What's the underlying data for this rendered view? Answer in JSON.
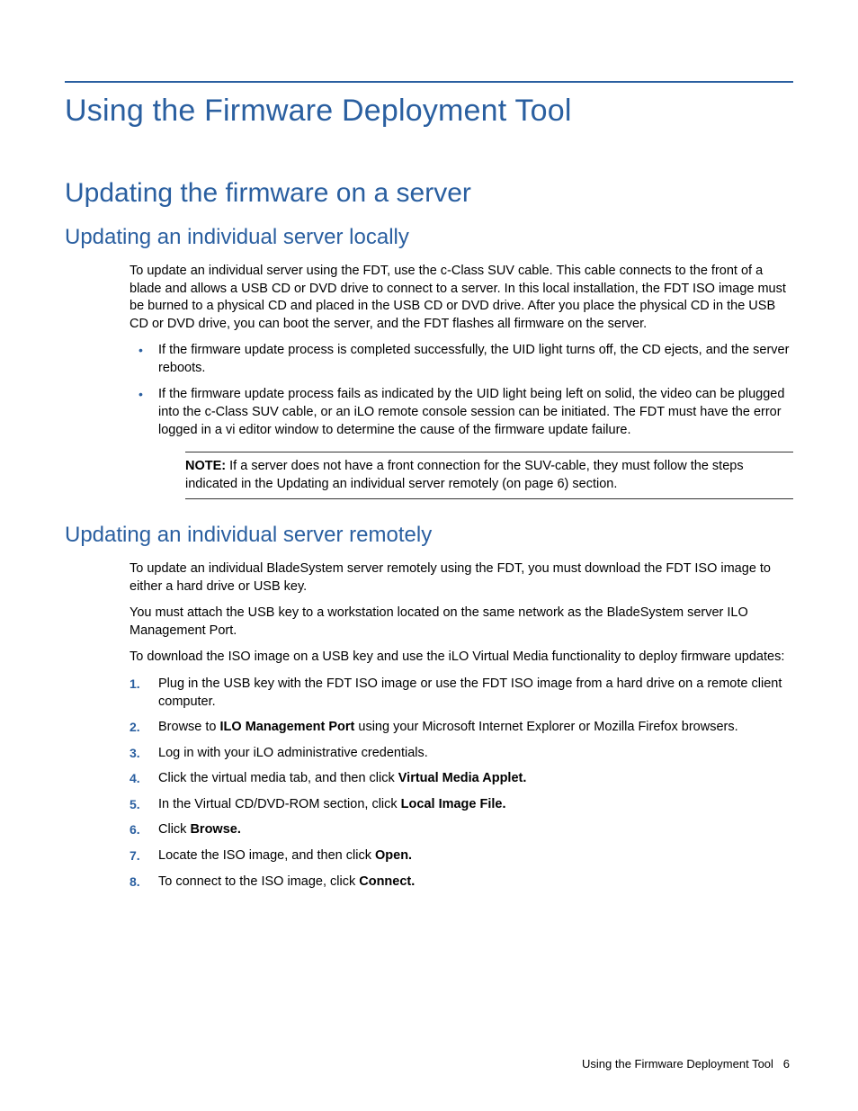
{
  "h1": "Using the Firmware Deployment Tool",
  "h2": "Updating the firmware on a server",
  "sec1": {
    "h3": "Updating an individual server locally",
    "p1": "To update an individual server using the FDT, use the c-Class SUV cable. This cable connects to the front of a blade and allows a USB CD or DVD drive to connect to a server. In this local installation, the FDT ISO image must be burned to a physical CD and placed in the USB CD or DVD drive. After you place the physical CD  in the USB CD or DVD drive, you can boot the server, and the FDT flashes all firmware on the server.",
    "b1": "If the firmware update process is completed successfully, the UID light turns off, the CD ejects, and the server reboots.",
    "b2": "If the firmware update process fails as indicated by the UID light being left on solid, the video can be plugged into the c-Class SUV cable, or an iLO remote console session can be initiated. The FDT must have the error logged in a vi editor window to determine the cause of the firmware update failure.",
    "note_label": "NOTE:",
    "note_body": "  If a server does not have a front connection for the SUV-cable, they must follow the steps indicated in the Updating an individual server remotely (on page 6) section."
  },
  "sec2": {
    "h3": "Updating an individual server remotely",
    "p1": "To update an individual BladeSystem server remotely using the FDT, you must download the FDT ISO image to either a hard drive or USB key.",
    "p2": "You must attach the USB key to a workstation located on the same network as the BladeSystem server ILO Management Port.",
    "p3": "To download the ISO image on a USB key and use the iLO Virtual Media functionality to deploy firmware updates:",
    "s1": "Plug in the USB key with the FDT ISO image or use the FDT ISO image from a hard drive on a remote client computer.",
    "s2a": "Browse to ",
    "s2b": "ILO Management Port",
    "s2c": " using your Microsoft Internet Explorer or Mozilla Firefox browsers.",
    "s3": "Log in with your iLO administrative credentials.",
    "s4a": "Click the virtual media tab, and then click ",
    "s4b": "Virtual Media Applet.",
    "s5a": "In the Virtual CD/DVD-ROM section, click ",
    "s5b": "Local Image File.",
    "s6a": "Click ",
    "s6b": "Browse.",
    "s7a": "Locate the ISO image, and then click ",
    "s7b": "Open.",
    "s8a": "To connect to the ISO image, click ",
    "s8b": "Connect."
  },
  "footer_text": "Using the Firmware Deployment Tool",
  "footer_page": "6"
}
